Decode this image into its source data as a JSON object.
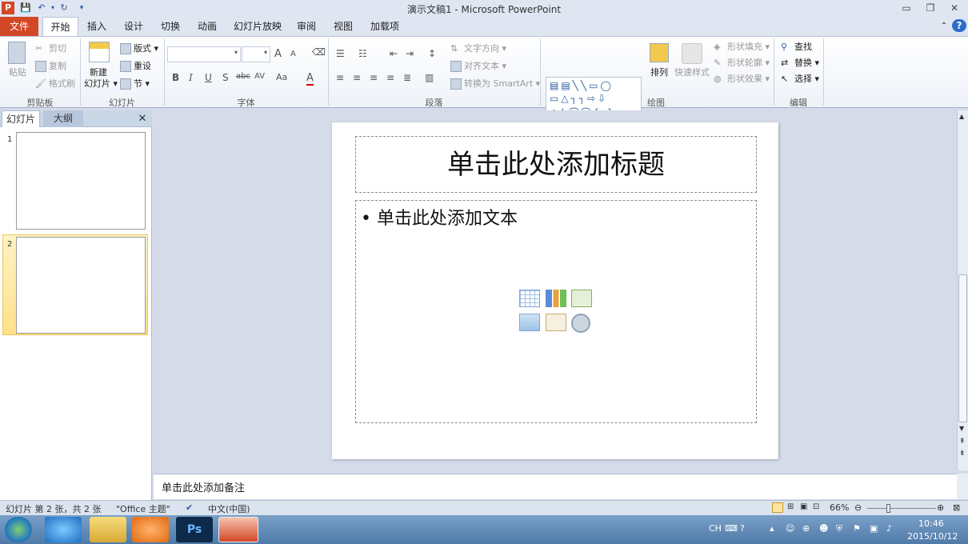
{
  "app": {
    "title": "演示文稿1 - Microsoft PowerPoint",
    "logo_letter": "P"
  },
  "window_controls": {
    "minimize": "▭",
    "restore": "❐",
    "close": "✕"
  },
  "quick_access": {
    "save": "💾",
    "undo": "↶",
    "redo": "↻",
    "customize": "▾"
  },
  "tabs": [
    "文件",
    "开始",
    "插入",
    "设计",
    "切换",
    "动画",
    "幻灯片放映",
    "审阅",
    "视图",
    "加载项"
  ],
  "ribbon": {
    "clipboard": {
      "paste": "粘贴",
      "cut": "剪切",
      "copy": "复制",
      "format_painter": "格式刷",
      "group": "剪贴板"
    },
    "slides": {
      "new_slide_line1": "新建",
      "new_slide_line2": "幻灯片",
      "layout": "版式",
      "reset": "重设",
      "section": "节",
      "group": "幻灯片"
    },
    "font": {
      "group": "字体",
      "grow": "A",
      "shrink": "A",
      "bold": "B",
      "italic": "I",
      "underline": "U",
      "shadow": "S",
      "strike": "abc",
      "spacing": "AV",
      "case": "Aa",
      "color": "A"
    },
    "paragraph": {
      "group": "段落",
      "text_direction": "文字方向",
      "align_text": "对齐文本",
      "smartart": "转换为 SmartArt"
    },
    "drawing": {
      "group": "绘图",
      "arrange": "排列",
      "quick_styles": "快速样式",
      "shape_fill": "形状填充",
      "shape_outline": "形状轮廓",
      "shape_effects": "形状效果"
    },
    "editing": {
      "group": "编辑",
      "find": "查找",
      "replace": "替换",
      "select": "选择"
    }
  },
  "pane": {
    "tab_slides": "幻灯片",
    "tab_outline": "大纲",
    "close": "✕",
    "slide_numbers": [
      "1",
      "2"
    ]
  },
  "slide": {
    "title_placeholder": "单击此处添加标题",
    "body_placeholder": "• 单击此处添加文本"
  },
  "notes": {
    "placeholder": "单击此处添加备注"
  },
  "status": {
    "slide_info": "幻灯片 第 2 张，共 2 张",
    "theme": "\"Office 主题\"",
    "language": "中文(中国)",
    "zoom": "66%"
  },
  "taskbar": {
    "ime": "CH",
    "time": "10:46",
    "date": "2015/10/12"
  }
}
